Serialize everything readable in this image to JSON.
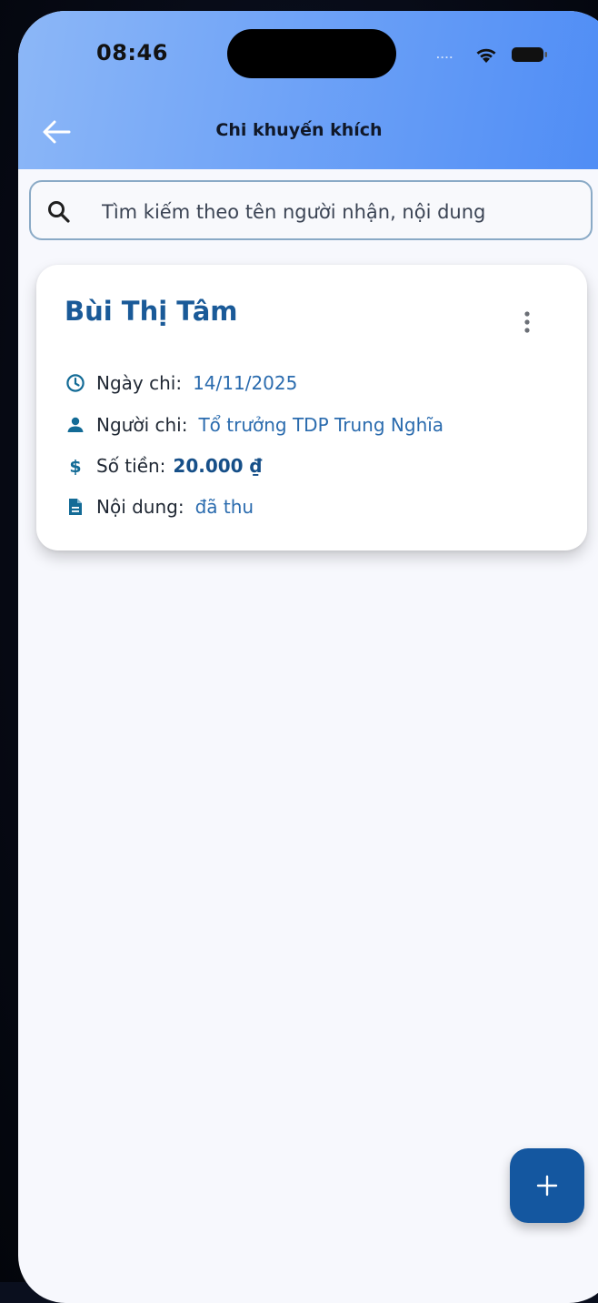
{
  "status_bar": {
    "time": "08:46",
    "signal": "....",
    "icons": [
      "wifi-icon",
      "battery-icon"
    ]
  },
  "header": {
    "title": "Chi khuyến khích",
    "back_icon": "arrow-left-icon"
  },
  "search": {
    "placeholder": "Tìm kiếm theo tên người nhận, nội dung",
    "value": "",
    "icon": "search-icon"
  },
  "records": [
    {
      "recipient": "Bùi Thị Tâm",
      "menu_icon": "more-vertical-icon",
      "fields": {
        "date": {
          "icon": "clock-icon",
          "label": "Ngày chi:",
          "value": "14/11/2025"
        },
        "payer": {
          "icon": "person-icon",
          "label": "Người chi:",
          "value": "Tổ trưởng TDP Trung Nghĩa"
        },
        "amount": {
          "icon": "dollar-icon",
          "label": "Số tiền:",
          "value": "20.000 ₫"
        },
        "content": {
          "icon": "document-icon",
          "label": "Nội dung:",
          "value": "đã thu"
        }
      }
    }
  ],
  "fab": {
    "icon": "plus-icon"
  },
  "colors": {
    "header_gradient_start": "#8cb7f7",
    "header_gradient_end": "#4e8cf5",
    "accent": "#1a5a98",
    "icon": "#136b96",
    "fab": "#1457a0",
    "background": "#f7f8fd"
  }
}
